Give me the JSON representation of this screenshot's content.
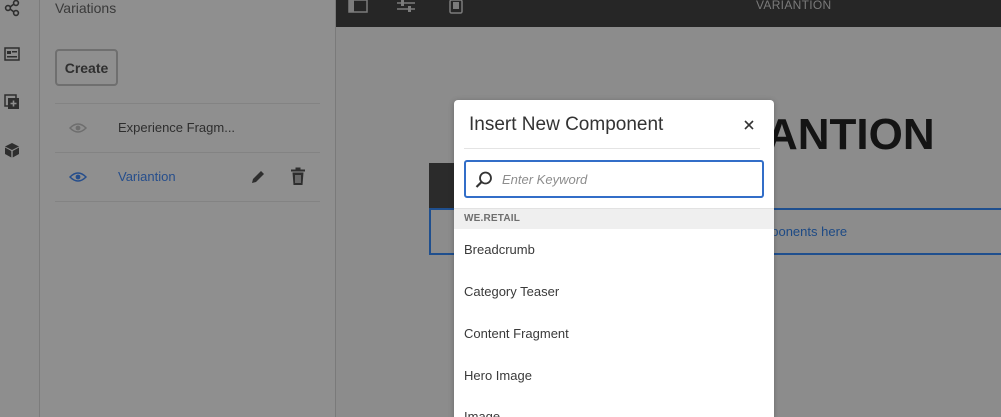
{
  "rail": {
    "icons": [
      "share-icon",
      "fragment-icon",
      "add-layer-icon",
      "package-icon"
    ]
  },
  "panel": {
    "title": "Variations",
    "create_label": "Create",
    "variations": [
      {
        "label": "Experience Fragm...",
        "active": false
      },
      {
        "label": "Variantion",
        "active": true
      }
    ]
  },
  "editor": {
    "toolbar_icons": [
      "sidebar-toggle-icon",
      "properties-icon",
      "emulator-icon"
    ],
    "page_title": "VARIANTION",
    "heading_text": "ANTION",
    "drag_text": "nponents here"
  },
  "dialog": {
    "title": "Insert New Component",
    "close_glyph": "×",
    "search_placeholder": "Enter Keyword",
    "search_value": "",
    "group": "WE.RETAIL",
    "components": [
      "Breadcrumb",
      "Category Teaser",
      "Content Fragment",
      "Hero Image",
      "Image"
    ]
  },
  "colors": {
    "overlay": "#8c8c8c",
    "accent_blue": "#326ec8",
    "link_blue": "#264e8c",
    "toolbar": "#262626"
  }
}
